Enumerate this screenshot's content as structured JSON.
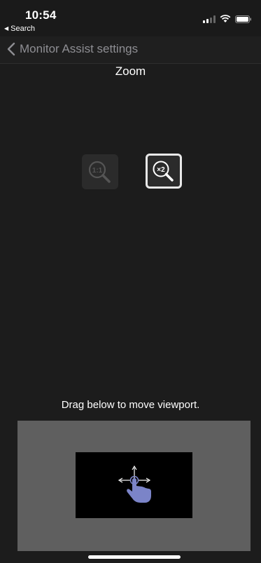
{
  "status_bar": {
    "time": "10:54",
    "back_app_label": "Search"
  },
  "nav": {
    "back_title": "Monitor Assist settings"
  },
  "zoom": {
    "title": "Zoom",
    "options": [
      {
        "label": "1:1",
        "selected": false
      },
      {
        "label": "×2",
        "selected": true
      }
    ]
  },
  "viewport": {
    "hint": "Drag below to move viewport."
  },
  "colors": {
    "background": "#1c1c1c",
    "viewport_area": "#5f5f5f",
    "hand_icon": "#7b84c8"
  },
  "icons": [
    "back-chevron-icon",
    "zoom-1to1-icon",
    "zoom-x2-icon",
    "drag-hand-icon"
  ]
}
